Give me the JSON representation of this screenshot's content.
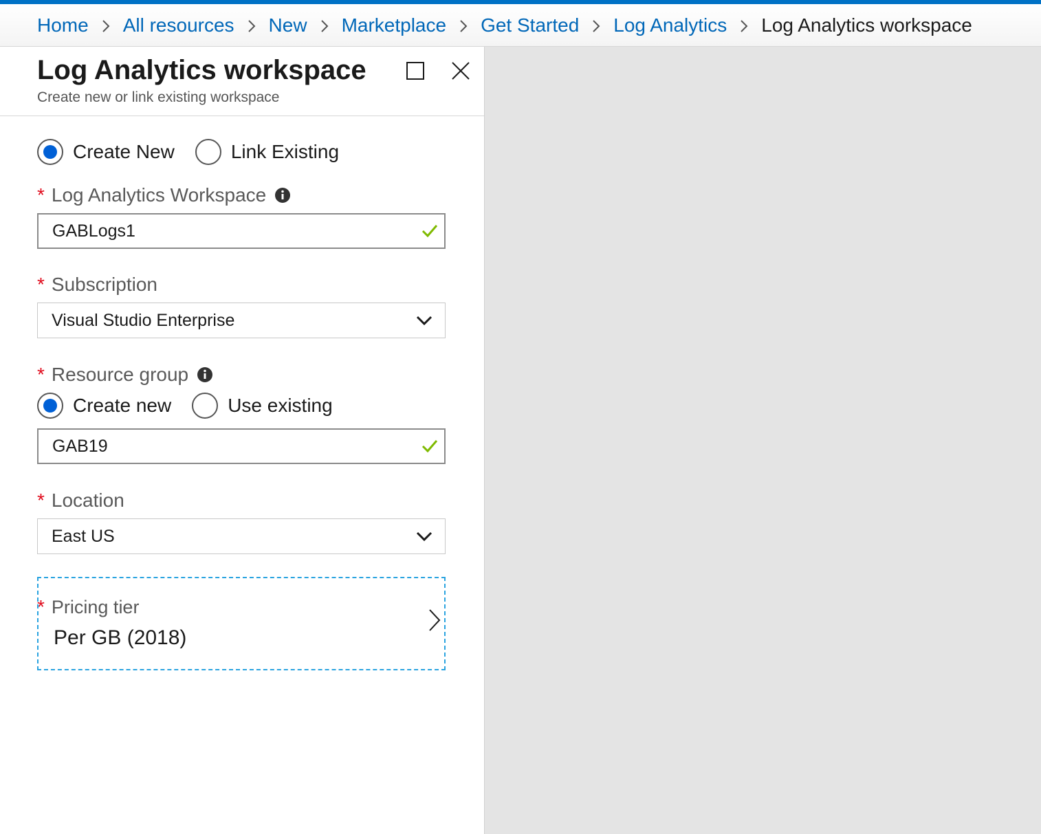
{
  "breadcrumb": {
    "items": [
      "Home",
      "All resources",
      "New",
      "Marketplace",
      "Get Started",
      "Log Analytics"
    ],
    "current": "Log Analytics workspace"
  },
  "blade": {
    "title": "Log Analytics workspace",
    "subtitle": "Create new or link existing workspace"
  },
  "mode": {
    "options": [
      "Create New",
      "Link Existing"
    ],
    "selected": "Create New"
  },
  "workspace": {
    "label": "Log Analytics Workspace",
    "value": "GABLogs1"
  },
  "subscription": {
    "label": "Subscription",
    "value": "Visual Studio Enterprise"
  },
  "resource_group": {
    "label": "Resource group",
    "options": [
      "Create new",
      "Use existing"
    ],
    "selected": "Create new",
    "value": "GAB19"
  },
  "location": {
    "label": "Location",
    "value": "East US"
  },
  "pricing": {
    "label": "Pricing tier",
    "value": "Per GB (2018)"
  },
  "required_marker": "*",
  "colors": {
    "accent_blue": "#0072c6",
    "link_blue": "#0067b8",
    "radio_selected": "#0060d6",
    "required_red": "#e00b1c",
    "valid_green": "#7fba00",
    "focus_dashed": "#29a3e0",
    "right_pane_gray": "#e4e4e4"
  },
  "icons": {
    "breadcrumb_separator": "chevron-right-icon",
    "maximize": "maximize-icon",
    "close": "close-icon",
    "info": "info-icon",
    "valid": "checkmark-icon",
    "dropdown": "chevron-down-icon",
    "pricing_open": "chevron-right-icon"
  }
}
